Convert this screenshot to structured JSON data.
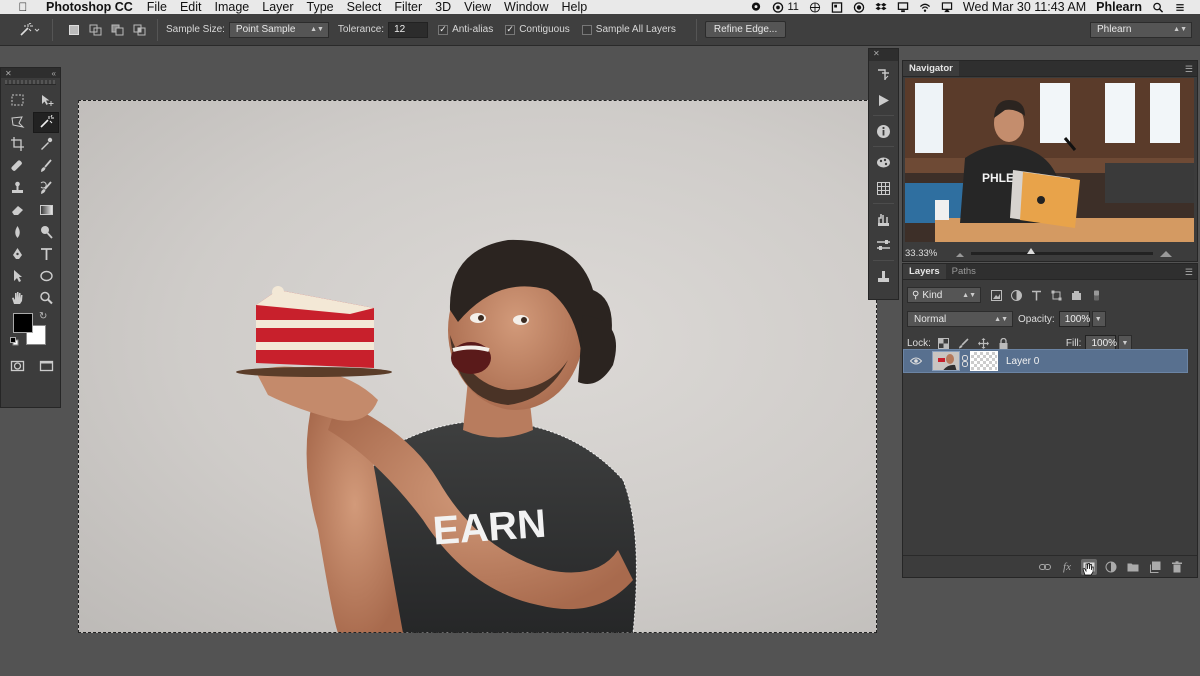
{
  "menubar": {
    "app_name": "Photoshop CC",
    "items": [
      "File",
      "Edit",
      "Image",
      "Layer",
      "Type",
      "Select",
      "Filter",
      "3D",
      "View",
      "Window",
      "Help"
    ],
    "status_badge": "11",
    "datetime": "Wed Mar 30  11:43 AM",
    "user": "Phlearn"
  },
  "options": {
    "sample_size_label": "Sample Size:",
    "sample_size_value": "Point Sample",
    "tolerance_label": "Tolerance:",
    "tolerance_value": "12",
    "anti_alias_label": "Anti-alias",
    "anti_alias_checked": true,
    "contiguous_label": "Contiguous",
    "contiguous_checked": true,
    "sample_all_layers_label": "Sample All Layers",
    "sample_all_layers_checked": false,
    "refine_edge_label": "Refine Edge...",
    "workspace_value": "Phlearn"
  },
  "navigator": {
    "tab_label": "Navigator",
    "zoom": "33.33%",
    "zoom_fraction": 0.33,
    "thumbnail_text": "PHLEARN"
  },
  "layers_panel": {
    "tabs": [
      "Layers",
      "Paths"
    ],
    "filter_value": "Kind",
    "blend_mode": "Normal",
    "opacity_label": "Opacity:",
    "opacity_value": "100%",
    "lock_label": "Lock:",
    "fill_label": "Fill:",
    "fill_value": "100%",
    "layers": [
      {
        "name": "Layer 0",
        "visible": true,
        "selected": true,
        "has_mask": true
      }
    ]
  },
  "canvas": {
    "shirt_text": "EARN"
  },
  "colors": {
    "accent_selected_layer": "#58708f",
    "panel_bg": "#3c3c3c",
    "workspace_bg": "#535353"
  }
}
